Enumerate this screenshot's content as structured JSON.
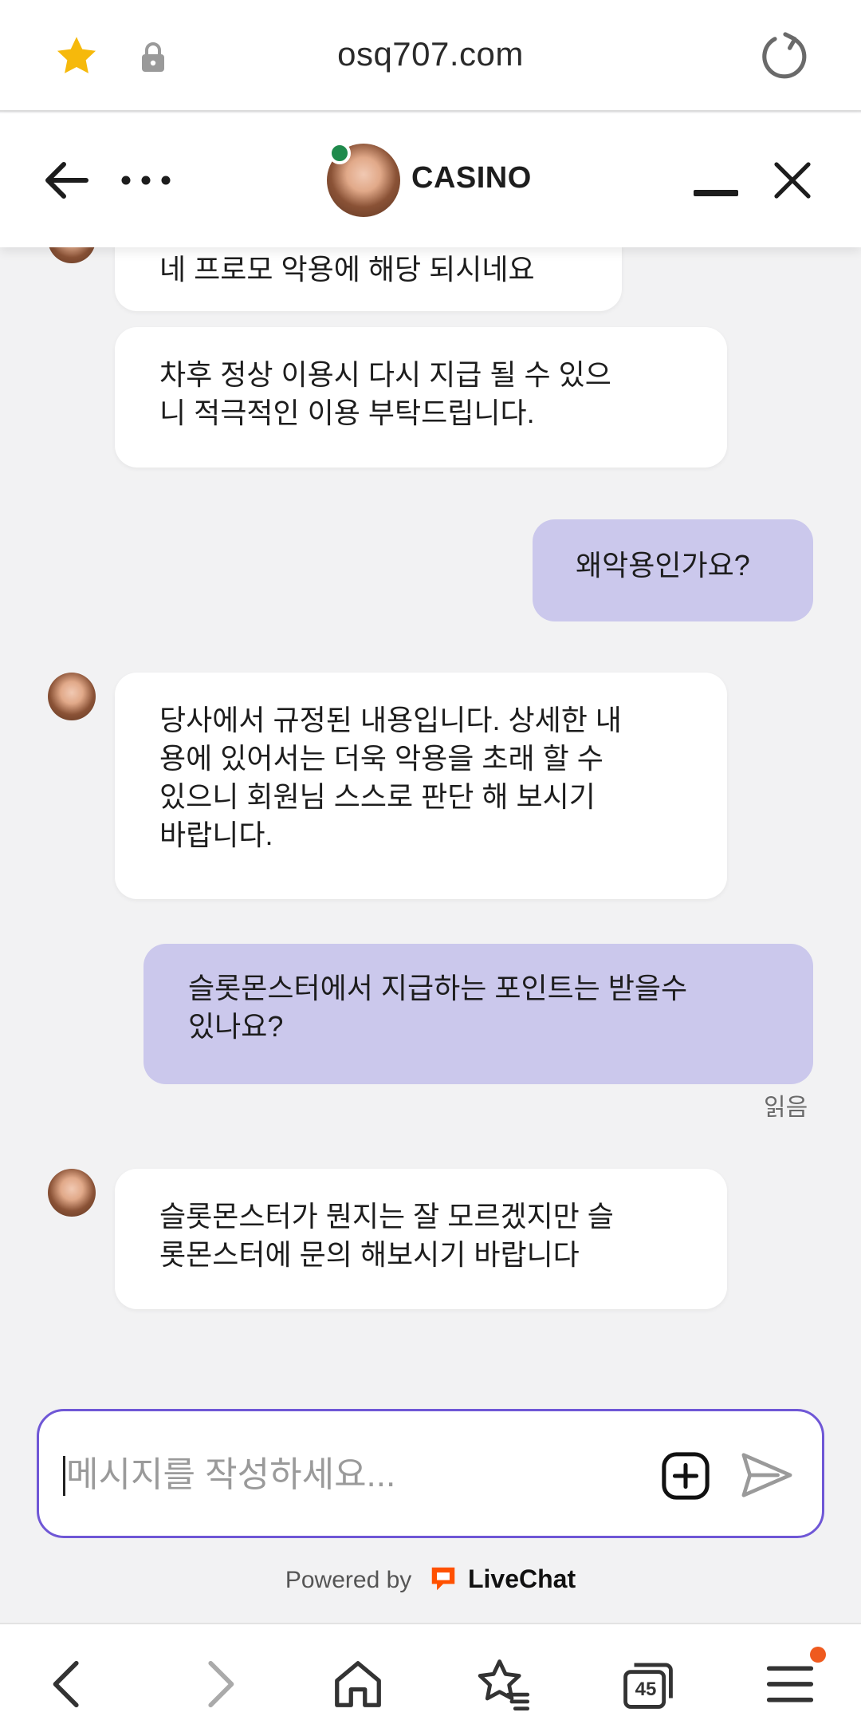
{
  "browser": {
    "url": "osq707.com",
    "tab_count": "45",
    "colors": {
      "star": "#f6b90b",
      "notify": "#ef5a1e"
    }
  },
  "header": {
    "title": "CASINO",
    "status": "online"
  },
  "messages": [
    {
      "sender": "agent",
      "text": "네 프로모 악용에 해당 되시네요"
    },
    {
      "sender": "agent",
      "text": "차후 정상 이용시 다시 지급 될 수 있으\n니 적극적인 이용 부탁드립니다."
    },
    {
      "sender": "user",
      "text": "왜악용인가요?"
    },
    {
      "sender": "agent",
      "text": "당사에서 규정된 내용입니다. 상세한 내\n용에 있어서는 더욱 악용을 초래 할 수\n있으니 회원님 스스로 판단 해 보시기\n바랍니다."
    },
    {
      "sender": "user",
      "text": "슬롯몬스터에서 지급하는 포인트는 받을수\n있나요?",
      "read_label": "읽음"
    },
    {
      "sender": "agent",
      "text": "슬롯몬스터가 뭔지는 잘 모르겠지만 슬\n롯몬스터에 문의 해보시기 바랍니다"
    }
  ],
  "composer": {
    "placeholder": "메시지를 작성하세요..."
  },
  "footer": {
    "powered_by": "Powered by",
    "brand": "LiveChat"
  },
  "theme": {
    "user_bubble": "#cbc8ec",
    "agent_bubble": "#ffffff",
    "composer_border": "#6f57d6"
  }
}
